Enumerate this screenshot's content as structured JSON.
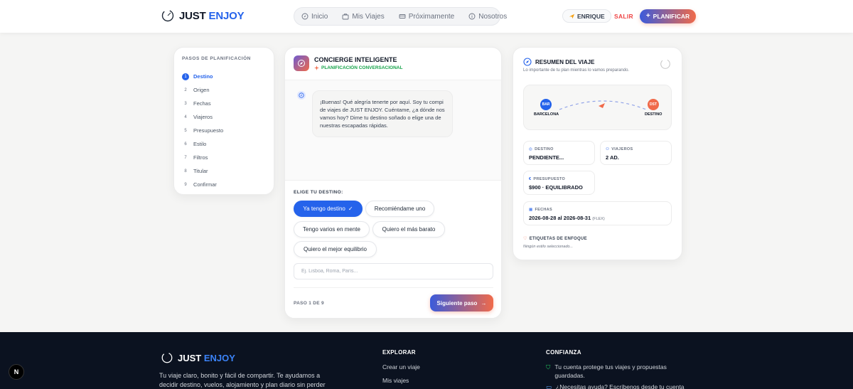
{
  "header": {
    "logo_part1": "JUST",
    "logo_part2": "ENJOY",
    "nav": [
      {
        "label": "Inicio",
        "icon": "compass-icon"
      },
      {
        "label": "Mis Viajes",
        "icon": "suitcase-icon"
      },
      {
        "label": "Próximamente",
        "icon": "ticket-icon"
      },
      {
        "label": "Nosotros",
        "icon": "info-icon"
      }
    ],
    "user_name": "ENRIQUE",
    "logout_label": "SALIR",
    "plan_button": "PLANIFICAR"
  },
  "steps": {
    "title": "PASOS DE PLANIFICACIÓN",
    "items": [
      {
        "num": "1",
        "label": "Destino",
        "active": true
      },
      {
        "num": "2",
        "label": "Origen"
      },
      {
        "num": "3",
        "label": "Fechas"
      },
      {
        "num": "4",
        "label": "Viajeros"
      },
      {
        "num": "5",
        "label": "Presupuesto"
      },
      {
        "num": "6",
        "label": "Estilo"
      },
      {
        "num": "7",
        "label": "Filtros"
      },
      {
        "num": "8",
        "label": "Titular"
      },
      {
        "num": "9",
        "label": "Confirmar"
      }
    ]
  },
  "chat": {
    "title": "CONCIERGE INTELIGENTE",
    "subtitle": "PLANIFICACIÓN CONVERSACIONAL",
    "message_lines": [
      "¡Buenas! Qué alegría tenerte por aquí. Soy tu compi",
      "de viajes de JUST ENJOY. Cuéntame, ¿a dónde nos",
      "vamos hoy? Dime tu destino soñado o elige una de",
      "nuestras escapadas rápidas."
    ],
    "choose_label": "ELIGE TU DESTINO:",
    "chips": [
      "Ya tengo destino",
      "Recomiéndame uno",
      "Tengo varios en mente",
      "Quiero el más barato",
      "Quiero el mejor equilibrio"
    ],
    "input_placeholder": "Ej. Lisboa, Roma, París...",
    "step_count": "PASO 1 DE 9",
    "next_button": "Siguiente paso"
  },
  "summary": {
    "title": "RESUMEN DEL VIAJE",
    "subtitle": "Lo importante de tu plan mientras lo vamos preparando.",
    "origin_code": "BAR",
    "origin_label": "BARCELONA",
    "dest_code": "DST",
    "dest_label": "DESTINO",
    "destino_key": "DESTINO",
    "destino_value": "PENDIENTE...",
    "viajeros_key": "VIAJEROS",
    "viajeros_value": "2 AD.",
    "presupuesto_key": "PRESUPUESTO",
    "presupuesto_value": "$900 · EQUILIBRADO",
    "fechas_key": "FECHAS",
    "fechas_value": "2026-08-28 al 2026-08-31",
    "fechas_flex": "(FLEX)",
    "tags_key": "ETIQUETAS DE ENFOQUE",
    "tags_value": "Ningún estilo seleccionado..."
  },
  "footer": {
    "logo_part1": "JUST",
    "logo_part2": "ENJOY",
    "desc_lines": [
      "Tu viaje claro, bonito y fácil de compartir. Te ayudamos a",
      "decidir destino, vuelos, alojamiento y plan diario sin perder"
    ],
    "explore_title": "EXPLORAR",
    "explore_links": [
      "Crear un viaje",
      "Mis viajes"
    ],
    "trust_title": "CONFIANZA",
    "trust_item": "Tu cuenta protege tus viajes y propuestas guardadas.",
    "trust_item2": "¿Necesitas ayuda? Escríbenos desde tu cuenta"
  },
  "next_badge": "N",
  "colors": {
    "primary": "#2563eb",
    "accent": "#f06a4a",
    "success": "#16a34a",
    "footer_bg": "#0b1220"
  }
}
